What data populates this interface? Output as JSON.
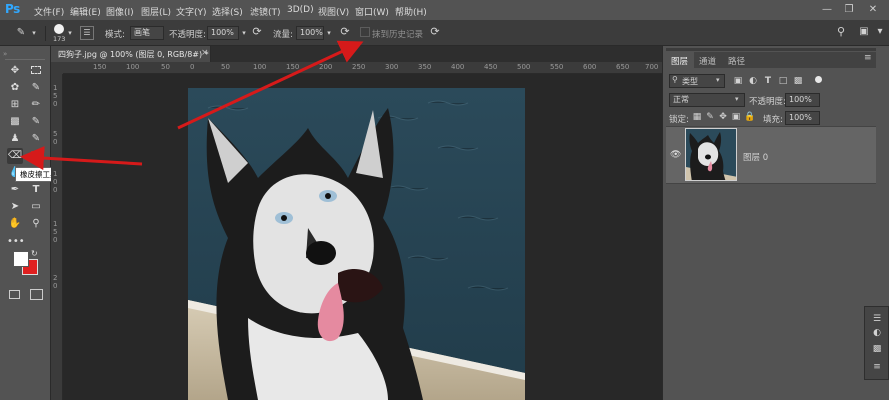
{
  "app": {
    "logo": "Ps"
  },
  "menu": [
    "文件(F)",
    "编辑(E)",
    "图像(I)",
    "图层(L)",
    "文字(Y)",
    "选择(S)",
    "滤镜(T)",
    "3D(D)",
    "视图(V)",
    "窗口(W)",
    "帮助(H)"
  ],
  "options": {
    "brush_size": "173",
    "mode_label": "模式:",
    "mode_value": "画笔",
    "opacity_label": "不透明度:",
    "opacity_value": "100%",
    "flow_label": "流量:",
    "flow_value": "100%",
    "erase_history": "抹到历史记录"
  },
  "document": {
    "tab_title": "四狗子.jpg @ 100% (图层 0, RGB/8#) *",
    "ruler_top": [
      "150",
      "100",
      "50",
      "0",
      "50",
      "100",
      "150",
      "200",
      "250",
      "300",
      "350",
      "400",
      "450",
      "500",
      "550",
      "600",
      "650",
      "700"
    ],
    "ruler_left": [
      "1",
      "5",
      "0",
      "5",
      "0",
      "1",
      "0",
      "0",
      "1",
      "5",
      "0",
      "2",
      "0"
    ]
  },
  "tooltip": "橡皮擦工具 (E)",
  "layers_panel": {
    "tabs": [
      "图层",
      "通道",
      "路径"
    ],
    "filter_kind": "类型",
    "blend_mode": "正常",
    "opacity_label": "不透明度:",
    "opacity_value": "100%",
    "lock_label": "锁定:",
    "fill_label": "填充:",
    "fill_value": "100%",
    "layer_name": "图层 0"
  },
  "colors": {
    "accent": "#31a8ff",
    "foreground_swatch": "#ffffff",
    "background_swatch": "#e02020",
    "annotation_arrow": "#d61a1a"
  },
  "icons": {
    "menubar": [
      "minimize-icon",
      "restore-icon",
      "close-icon"
    ],
    "options_right": [
      "search-icon",
      "workspace-icon",
      "share-icon"
    ]
  }
}
